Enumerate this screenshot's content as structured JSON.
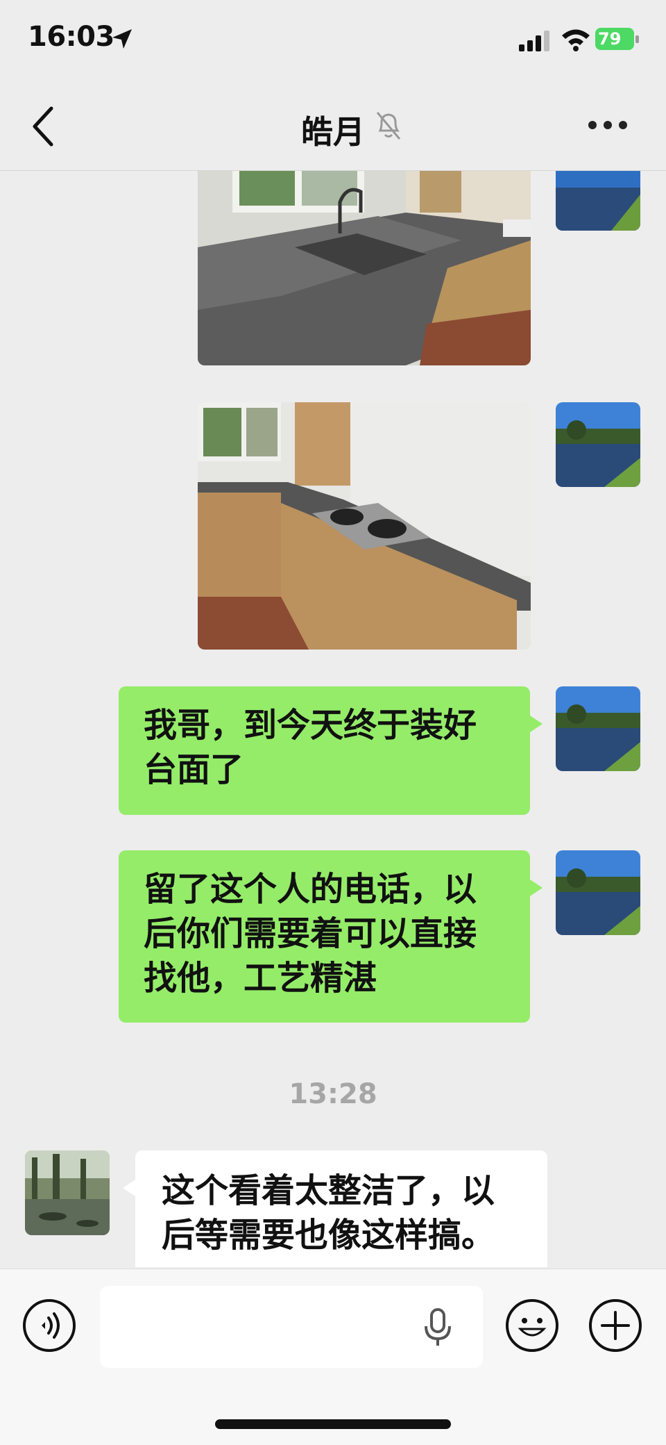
{
  "status_bar": {
    "time": "16:03",
    "battery": "79"
  },
  "header": {
    "title": "皓月"
  },
  "messages": [
    {
      "from": "me",
      "type": "image",
      "content": "kitchen sink countertop photo"
    },
    {
      "from": "me",
      "type": "image",
      "content": "kitchen stove countertop photo"
    },
    {
      "from": "me",
      "type": "text",
      "text": "我哥，到今天终于装好台面了"
    },
    {
      "from": "me",
      "type": "text",
      "text": "留了这个人的电话，以后你们需要着可以直接找他，工艺精湛"
    },
    {
      "type": "timestamp",
      "text": "13:28"
    },
    {
      "from": "other",
      "type": "text",
      "text": "这个看着太整洁了，以后等需要也像这样搞。"
    }
  ],
  "input_bar": {
    "voice_icon": "voice-icon",
    "mic_icon": "mic-icon",
    "emoji_icon": "emoji-icon",
    "plus_icon": "plus-icon"
  },
  "colors": {
    "outgoing_bubble": "#95ec69",
    "incoming_bubble": "#ffffff",
    "background": "#ededed",
    "battery": "#4cd964"
  }
}
